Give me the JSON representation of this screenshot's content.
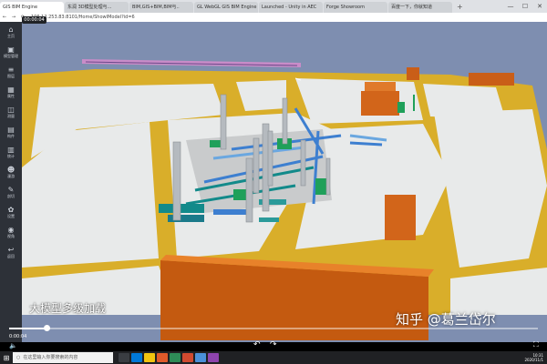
{
  "browser": {
    "tabs": [
      {
        "label": "GIS BIM Engine",
        "active": true
      },
      {
        "label": "东润 3D模型处理与...",
        "active": false
      },
      {
        "label": "BIM,GIS+BIM,BIM与..",
        "active": false
      },
      {
        "label": "GL WebGL GIS BIM Engine",
        "active": false
      },
      {
        "label": "Launched - Unity in AEC",
        "active": false
      },
      {
        "label": "Forge Showroom",
        "active": false
      },
      {
        "label": "百度一下，你就知道",
        "active": false
      }
    ],
    "new_tab": "+",
    "window_controls": [
      "—",
      "☐",
      "✕"
    ],
    "nav": [
      "←",
      "→",
      "⟳"
    ],
    "url": "106.12.253.83:8101/Home/ShowIModel?id=6"
  },
  "recording_time": "00:00:04",
  "sidebar": {
    "items": [
      {
        "icon": "home-icon",
        "glyph": "⌂",
        "label": "主页"
      },
      {
        "icon": "cube-icon",
        "glyph": "▣",
        "label": "模型管理"
      },
      {
        "icon": "layers-icon",
        "glyph": "≡",
        "label": "图层"
      },
      {
        "icon": "grid-icon",
        "glyph": "▦",
        "label": "属性"
      },
      {
        "icon": "measure-icon",
        "glyph": "◫",
        "label": "测量"
      },
      {
        "icon": "document-icon",
        "glyph": "▤",
        "label": "构件"
      },
      {
        "icon": "chart-icon",
        "glyph": "▥",
        "label": "统计"
      },
      {
        "icon": "user-icon",
        "glyph": "☻",
        "label": "漫游"
      },
      {
        "icon": "wrench-icon",
        "glyph": "✎",
        "label": "剖切"
      },
      {
        "icon": "settings-icon",
        "glyph": "✿",
        "label": "设置"
      },
      {
        "icon": "camera-icon",
        "glyph": "◉",
        "label": "视角"
      },
      {
        "icon": "back-icon",
        "glyph": "↩",
        "label": "返回"
      }
    ]
  },
  "caption": "大模型多级加载",
  "watermark": "知乎 @葛兰岱尔",
  "player": {
    "elapsed": "0:00:04",
    "progress": 0.07,
    "volume_icon": "🔈",
    "controls": [
      "↶",
      "↷"
    ],
    "fullscreen_icon": "⛶"
  },
  "taskbar": {
    "start_icon": "⊞",
    "search_icon": "○",
    "search_placeholder": "在这里输入你要搜索的内容",
    "apps": [
      "#3a3d42",
      "#0078d7",
      "#f1c40f",
      "#e05a2a",
      "#2e8b57",
      "#d04a30",
      "#4a90d9",
      "#8e44ad"
    ],
    "clock": "10:31",
    "date": "2020/11/1"
  },
  "colors": {
    "sky": "#7e8eb0",
    "road": "#d9ae2a",
    "ground": "#e8eaea",
    "platform": "#c4c6c7",
    "orange": "#e0701a",
    "green": "#1fa05a",
    "teal": "#128a8a",
    "blue": "#3d7fd0",
    "pipe": "#b5babf"
  }
}
